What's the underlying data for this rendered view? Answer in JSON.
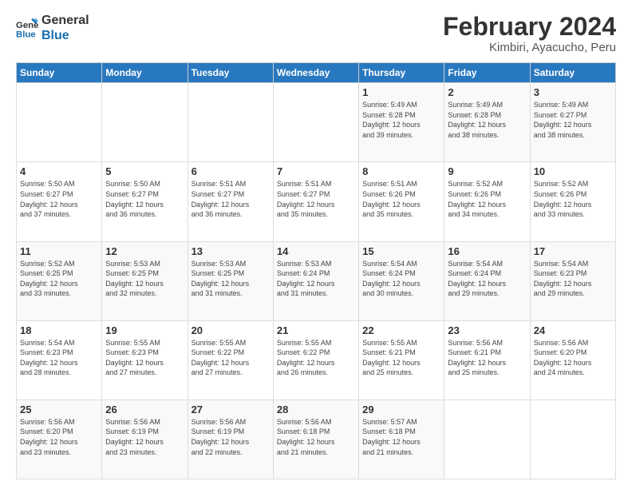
{
  "logo": {
    "line1": "General",
    "line2": "Blue"
  },
  "title": "February 2024",
  "subtitle": "Kimbiri, Ayacucho, Peru",
  "days_of_week": [
    "Sunday",
    "Monday",
    "Tuesday",
    "Wednesday",
    "Thursday",
    "Friday",
    "Saturday"
  ],
  "weeks": [
    [
      {
        "day": "",
        "info": ""
      },
      {
        "day": "",
        "info": ""
      },
      {
        "day": "",
        "info": ""
      },
      {
        "day": "",
        "info": ""
      },
      {
        "day": "1",
        "info": "Sunrise: 5:49 AM\nSunset: 6:28 PM\nDaylight: 12 hours\nand 39 minutes."
      },
      {
        "day": "2",
        "info": "Sunrise: 5:49 AM\nSunset: 6:28 PM\nDaylight: 12 hours\nand 38 minutes."
      },
      {
        "day": "3",
        "info": "Sunrise: 5:49 AM\nSunset: 6:27 PM\nDaylight: 12 hours\nand 38 minutes."
      }
    ],
    [
      {
        "day": "4",
        "info": "Sunrise: 5:50 AM\nSunset: 6:27 PM\nDaylight: 12 hours\nand 37 minutes."
      },
      {
        "day": "5",
        "info": "Sunrise: 5:50 AM\nSunset: 6:27 PM\nDaylight: 12 hours\nand 36 minutes."
      },
      {
        "day": "6",
        "info": "Sunrise: 5:51 AM\nSunset: 6:27 PM\nDaylight: 12 hours\nand 36 minutes."
      },
      {
        "day": "7",
        "info": "Sunrise: 5:51 AM\nSunset: 6:27 PM\nDaylight: 12 hours\nand 35 minutes."
      },
      {
        "day": "8",
        "info": "Sunrise: 5:51 AM\nSunset: 6:26 PM\nDaylight: 12 hours\nand 35 minutes."
      },
      {
        "day": "9",
        "info": "Sunrise: 5:52 AM\nSunset: 6:26 PM\nDaylight: 12 hours\nand 34 minutes."
      },
      {
        "day": "10",
        "info": "Sunrise: 5:52 AM\nSunset: 6:26 PM\nDaylight: 12 hours\nand 33 minutes."
      }
    ],
    [
      {
        "day": "11",
        "info": "Sunrise: 5:52 AM\nSunset: 6:25 PM\nDaylight: 12 hours\nand 33 minutes."
      },
      {
        "day": "12",
        "info": "Sunrise: 5:53 AM\nSunset: 6:25 PM\nDaylight: 12 hours\nand 32 minutes."
      },
      {
        "day": "13",
        "info": "Sunrise: 5:53 AM\nSunset: 6:25 PM\nDaylight: 12 hours\nand 31 minutes."
      },
      {
        "day": "14",
        "info": "Sunrise: 5:53 AM\nSunset: 6:24 PM\nDaylight: 12 hours\nand 31 minutes."
      },
      {
        "day": "15",
        "info": "Sunrise: 5:54 AM\nSunset: 6:24 PM\nDaylight: 12 hours\nand 30 minutes."
      },
      {
        "day": "16",
        "info": "Sunrise: 5:54 AM\nSunset: 6:24 PM\nDaylight: 12 hours\nand 29 minutes."
      },
      {
        "day": "17",
        "info": "Sunrise: 5:54 AM\nSunset: 6:23 PM\nDaylight: 12 hours\nand 29 minutes."
      }
    ],
    [
      {
        "day": "18",
        "info": "Sunrise: 5:54 AM\nSunset: 6:23 PM\nDaylight: 12 hours\nand 28 minutes."
      },
      {
        "day": "19",
        "info": "Sunrise: 5:55 AM\nSunset: 6:23 PM\nDaylight: 12 hours\nand 27 minutes."
      },
      {
        "day": "20",
        "info": "Sunrise: 5:55 AM\nSunset: 6:22 PM\nDaylight: 12 hours\nand 27 minutes."
      },
      {
        "day": "21",
        "info": "Sunrise: 5:55 AM\nSunset: 6:22 PM\nDaylight: 12 hours\nand 26 minutes."
      },
      {
        "day": "22",
        "info": "Sunrise: 5:55 AM\nSunset: 6:21 PM\nDaylight: 12 hours\nand 25 minutes."
      },
      {
        "day": "23",
        "info": "Sunrise: 5:56 AM\nSunset: 6:21 PM\nDaylight: 12 hours\nand 25 minutes."
      },
      {
        "day": "24",
        "info": "Sunrise: 5:56 AM\nSunset: 6:20 PM\nDaylight: 12 hours\nand 24 minutes."
      }
    ],
    [
      {
        "day": "25",
        "info": "Sunrise: 5:56 AM\nSunset: 6:20 PM\nDaylight: 12 hours\nand 23 minutes."
      },
      {
        "day": "26",
        "info": "Sunrise: 5:56 AM\nSunset: 6:19 PM\nDaylight: 12 hours\nand 23 minutes."
      },
      {
        "day": "27",
        "info": "Sunrise: 5:56 AM\nSunset: 6:19 PM\nDaylight: 12 hours\nand 22 minutes."
      },
      {
        "day": "28",
        "info": "Sunrise: 5:56 AM\nSunset: 6:18 PM\nDaylight: 12 hours\nand 21 minutes."
      },
      {
        "day": "29",
        "info": "Sunrise: 5:57 AM\nSunset: 6:18 PM\nDaylight: 12 hours\nand 21 minutes."
      },
      {
        "day": "",
        "info": ""
      },
      {
        "day": "",
        "info": ""
      }
    ]
  ]
}
